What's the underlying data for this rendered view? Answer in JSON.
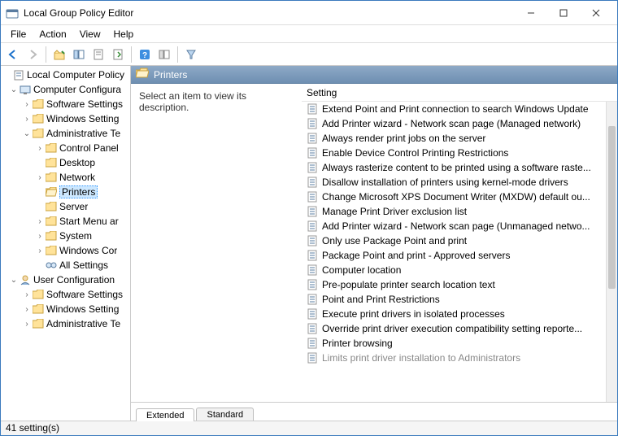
{
  "window": {
    "title": "Local Group Policy Editor"
  },
  "menu": {
    "file": "File",
    "action": "Action",
    "view": "View",
    "help": "Help"
  },
  "tree": {
    "root": "Local Computer Policy",
    "cc": "Computer Configura",
    "ss1": "Software Settings",
    "ws1": "Windows Setting",
    "at1": "Administrative Te",
    "cp": "Control Panel",
    "dk": "Desktop",
    "nw": "Network",
    "pr": "Printers",
    "sv": "Server",
    "sm": "Start Menu ar",
    "sy": "System",
    "wc": "Windows Cor",
    "as": "All Settings",
    "uc": "User Configuration",
    "ss2": "Software Settings",
    "ws2": "Windows Setting",
    "at2": "Administrative Te"
  },
  "right": {
    "header": "Printers",
    "desc": "Select an item to view its description.",
    "column": "Setting"
  },
  "settings": [
    "Extend Point and Print connection to search Windows Update",
    "Add Printer wizard - Network scan page (Managed network)",
    "Always render print jobs on the server",
    "Enable Device Control Printing Restrictions",
    "Always rasterize content to be printed using a software raste...",
    "Disallow installation of printers using kernel-mode drivers",
    "Change Microsoft XPS Document Writer (MXDW) default ou...",
    "Manage Print Driver exclusion list",
    "Add Printer wizard - Network scan page (Unmanaged netwo...",
    "Only use Package Point and print",
    "Package Point and print - Approved servers",
    "Computer location",
    "Pre-populate printer search location text",
    "Point and Print Restrictions",
    "Execute print drivers in isolated processes",
    "Override print driver execution compatibility setting reporte...",
    "Printer browsing",
    "Limits print driver installation to Administrators"
  ],
  "tabs": {
    "extended": "Extended",
    "standard": "Standard"
  },
  "status": "41 setting(s)"
}
